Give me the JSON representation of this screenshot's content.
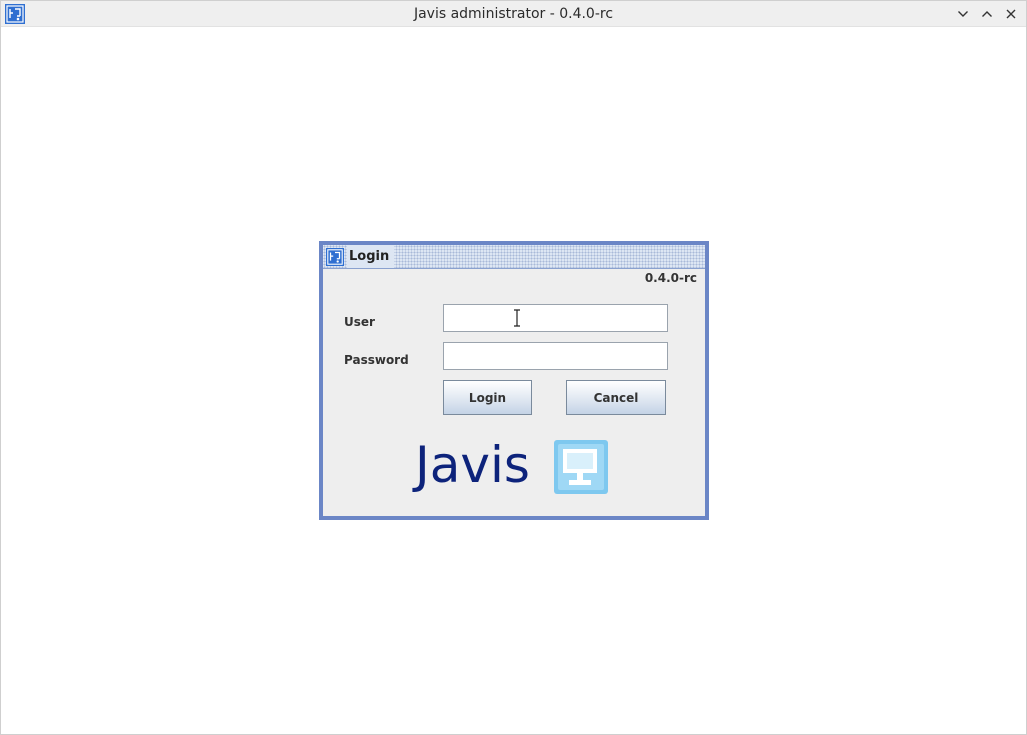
{
  "window": {
    "title": "Javis administrator - 0.4.0-rc",
    "icon": "javis-app-icon",
    "controls": [
      "minimize-icon",
      "maximize-icon",
      "close-icon"
    ]
  },
  "login_dialog": {
    "title": "Login",
    "version": "0.4.0-rc",
    "user_label": "User",
    "user_value": "",
    "password_label": "Password",
    "password_value": "",
    "login_button": "Login",
    "cancel_button": "Cancel",
    "logo_text": "Javis"
  },
  "colors": {
    "frame_border": "#6b86c6",
    "logo_text": "#0d237b",
    "logo_icon": "#7ec8ef"
  }
}
